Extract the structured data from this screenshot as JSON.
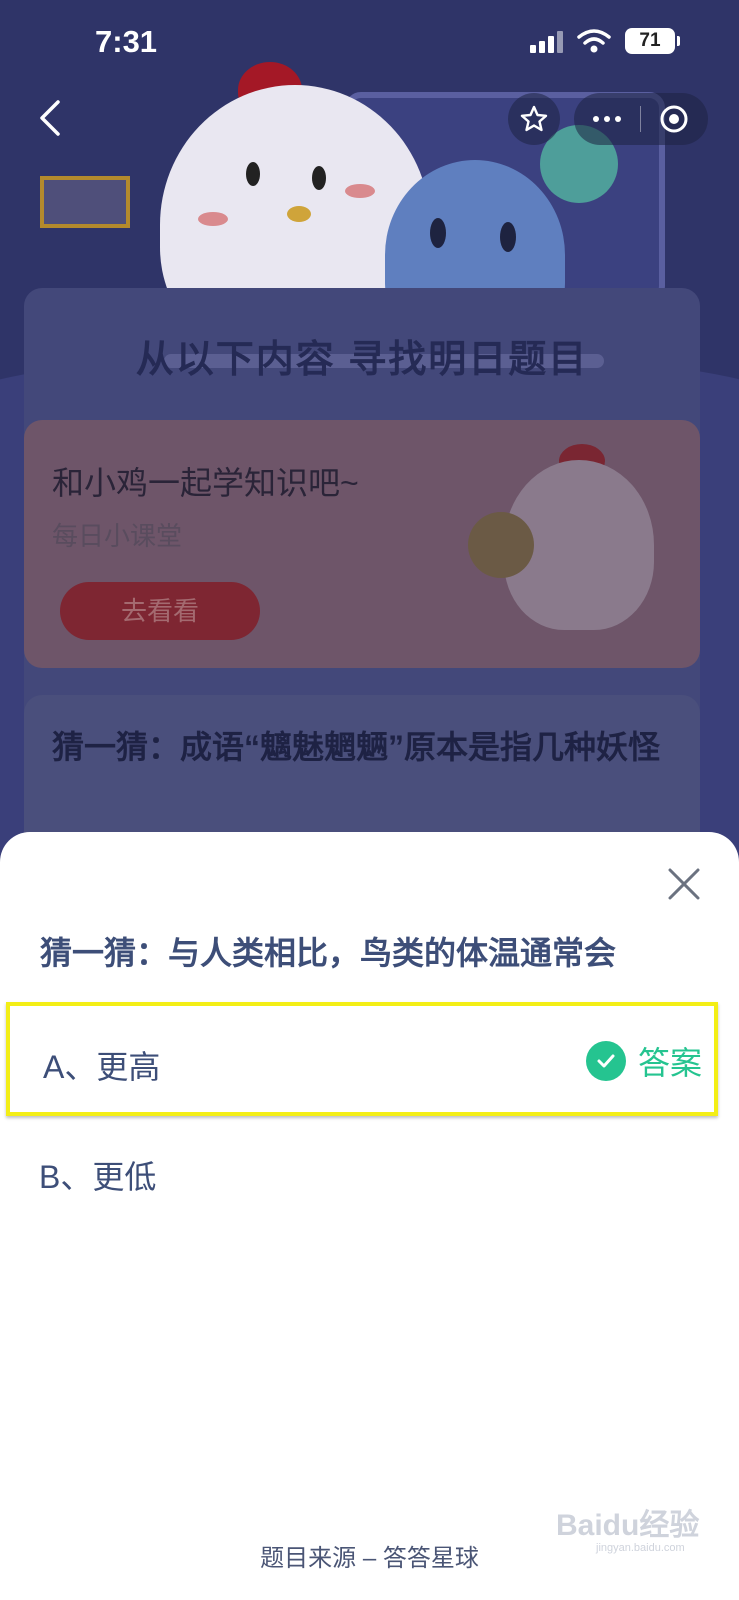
{
  "status_bar": {
    "time": "7:31",
    "battery": "71"
  },
  "nav": {
    "back_icon": "chevron-left-icon",
    "favorite_icon": "star-icon",
    "more_icon": "more-dots-icon",
    "close_icon": "target-icon"
  },
  "background_page": {
    "headline": "从以下内容 寻找明日题目",
    "promo_card": {
      "title": "和小鸡一起学知识吧~",
      "subtitle": "每日小课堂",
      "button_label": "去看看"
    },
    "quiz_card": {
      "title": "猜一猜：成语“魑魅魍魉”原本是指几种妖怪"
    }
  },
  "sheet": {
    "question": "猜一猜：与人类相比，鸟类的体温通常会",
    "options": [
      {
        "label": "A、更高",
        "is_answer": true,
        "answer_tag": "答案"
      },
      {
        "label": "B、更低",
        "is_answer": false
      }
    ],
    "source": "题目来源 – 答答星球",
    "colors": {
      "answer_green": "#25c490",
      "highlight_yellow": "#f3ee16",
      "text_blue": "#3d4e78"
    }
  },
  "watermark": {
    "text": "Baidu经验",
    "sub": "jingyan.baidu.com"
  }
}
